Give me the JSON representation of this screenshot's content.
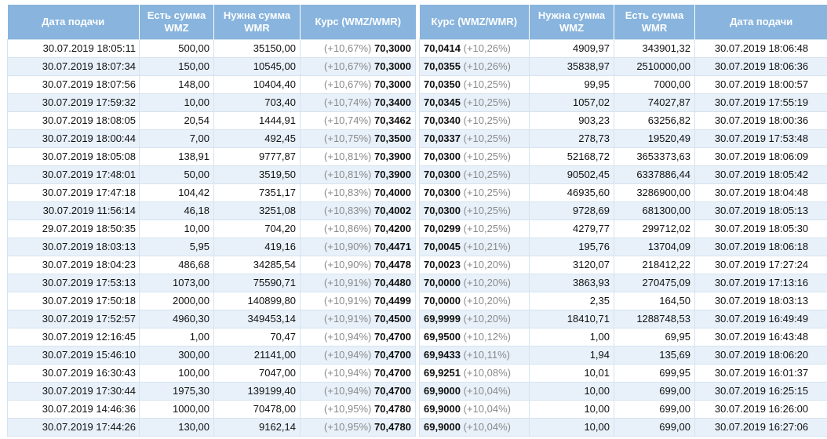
{
  "left_table": {
    "headers": [
      "Дата подачи",
      "Есть сумма WMZ",
      "Нужна сумма WMR",
      "Курс (WMZ/WMR)"
    ],
    "rows": [
      {
        "date": "30.07.2019 18:05:11",
        "have": "500,00",
        "need": "35150,00",
        "pct": "(+10,67%)",
        "rate": "70,3000"
      },
      {
        "date": "30.07.2019 18:07:34",
        "have": "150,00",
        "need": "10545,00",
        "pct": "(+10,67%)",
        "rate": "70,3000"
      },
      {
        "date": "30.07.2019 18:07:56",
        "have": "148,00",
        "need": "10404,40",
        "pct": "(+10,67%)",
        "rate": "70,3000"
      },
      {
        "date": "30.07.2019 17:59:32",
        "have": "10,00",
        "need": "703,40",
        "pct": "(+10,74%)",
        "rate": "70,3400"
      },
      {
        "date": "30.07.2019 18:08:05",
        "have": "20,54",
        "need": "1444,91",
        "pct": "(+10,74%)",
        "rate": "70,3462"
      },
      {
        "date": "30.07.2019 18:00:44",
        "have": "7,00",
        "need": "492,45",
        "pct": "(+10,75%)",
        "rate": "70,3500"
      },
      {
        "date": "30.07.2019 18:05:08",
        "have": "138,91",
        "need": "9777,87",
        "pct": "(+10,81%)",
        "rate": "70,3900"
      },
      {
        "date": "30.07.2019 17:48:01",
        "have": "50,00",
        "need": "3519,50",
        "pct": "(+10,81%)",
        "rate": "70,3900"
      },
      {
        "date": "30.07.2019 17:47:18",
        "have": "104,42",
        "need": "7351,17",
        "pct": "(+10,83%)",
        "rate": "70,4000"
      },
      {
        "date": "30.07.2019 11:56:14",
        "have": "46,18",
        "need": "3251,08",
        "pct": "(+10,83%)",
        "rate": "70,4002"
      },
      {
        "date": "29.07.2019 18:50:35",
        "have": "10,00",
        "need": "704,20",
        "pct": "(+10,86%)",
        "rate": "70,4200"
      },
      {
        "date": "30.07.2019 18:03:13",
        "have": "5,95",
        "need": "419,16",
        "pct": "(+10,90%)",
        "rate": "70,4471"
      },
      {
        "date": "30.07.2019 18:04:23",
        "have": "486,68",
        "need": "34285,54",
        "pct": "(+10,90%)",
        "rate": "70,4478"
      },
      {
        "date": "30.07.2019 17:53:13",
        "have": "1073,00",
        "need": "75590,71",
        "pct": "(+10,91%)",
        "rate": "70,4480"
      },
      {
        "date": "30.07.2019 17:50:18",
        "have": "2000,00",
        "need": "140899,80",
        "pct": "(+10,91%)",
        "rate": "70,4499"
      },
      {
        "date": "30.07.2019 17:52:57",
        "have": "4960,30",
        "need": "349453,14",
        "pct": "(+10,91%)",
        "rate": "70,4500"
      },
      {
        "date": "30.07.2019 12:16:45",
        "have": "1,00",
        "need": "70,47",
        "pct": "(+10,94%)",
        "rate": "70,4700"
      },
      {
        "date": "30.07.2019 15:46:10",
        "have": "300,00",
        "need": "21141,00",
        "pct": "(+10,94%)",
        "rate": "70,4700"
      },
      {
        "date": "30.07.2019 16:30:43",
        "have": "100,00",
        "need": "7047,00",
        "pct": "(+10,94%)",
        "rate": "70,4700"
      },
      {
        "date": "30.07.2019 17:30:44",
        "have": "1975,30",
        "need": "139199,40",
        "pct": "(+10,94%)",
        "rate": "70,4700"
      },
      {
        "date": "30.07.2019 14:46:36",
        "have": "1000,00",
        "need": "70478,00",
        "pct": "(+10,95%)",
        "rate": "70,4780"
      },
      {
        "date": "30.07.2019 17:44:26",
        "have": "130,00",
        "need": "9162,14",
        "pct": "(+10,95%)",
        "rate": "70,4780"
      }
    ]
  },
  "right_table": {
    "headers": [
      "Курс (WMZ/WMR)",
      "Нужна сумма WMZ",
      "Есть сумма WMR",
      "Дата подачи"
    ],
    "rows": [
      {
        "rate": "70,0414",
        "pct": "(+10,26%)",
        "need": "4909,97",
        "have": "343901,32",
        "date": "30.07.2019 18:06:48"
      },
      {
        "rate": "70,0355",
        "pct": "(+10,26%)",
        "need": "35838,97",
        "have": "2510000,00",
        "date": "30.07.2019 18:06:36"
      },
      {
        "rate": "70,0350",
        "pct": "(+10,25%)",
        "need": "99,95",
        "have": "7000,00",
        "date": "30.07.2019 18:00:57"
      },
      {
        "rate": "70,0345",
        "pct": "(+10,25%)",
        "need": "1057,02",
        "have": "74027,87",
        "date": "30.07.2019 17:55:19"
      },
      {
        "rate": "70,0340",
        "pct": "(+10,25%)",
        "need": "903,23",
        "have": "63256,82",
        "date": "30.07.2019 18:00:36"
      },
      {
        "rate": "70,0337",
        "pct": "(+10,25%)",
        "need": "278,73",
        "have": "19520,49",
        "date": "30.07.2019 17:53:48"
      },
      {
        "rate": "70,0300",
        "pct": "(+10,25%)",
        "need": "52168,72",
        "have": "3653373,63",
        "date": "30.07.2019 18:06:09"
      },
      {
        "rate": "70,0300",
        "pct": "(+10,25%)",
        "need": "90502,45",
        "have": "6337886,44",
        "date": "30.07.2019 18:05:42"
      },
      {
        "rate": "70,0300",
        "pct": "(+10,25%)",
        "need": "46935,60",
        "have": "3286900,00",
        "date": "30.07.2019 18:04:48"
      },
      {
        "rate": "70,0300",
        "pct": "(+10,25%)",
        "need": "9728,69",
        "have": "681300,00",
        "date": "30.07.2019 18:05:13"
      },
      {
        "rate": "70,0299",
        "pct": "(+10,25%)",
        "need": "4279,77",
        "have": "299712,02",
        "date": "30.07.2019 18:05:30"
      },
      {
        "rate": "70,0045",
        "pct": "(+10,21%)",
        "need": "195,76",
        "have": "13704,09",
        "date": "30.07.2019 18:06:18"
      },
      {
        "rate": "70,0023",
        "pct": "(+10,20%)",
        "need": "3120,07",
        "have": "218412,22",
        "date": "30.07.2019 17:27:24"
      },
      {
        "rate": "70,0000",
        "pct": "(+10,20%)",
        "need": "3863,93",
        "have": "270475,09",
        "date": "30.07.2019 17:13:16"
      },
      {
        "rate": "70,0000",
        "pct": "(+10,20%)",
        "need": "2,35",
        "have": "164,50",
        "date": "30.07.2019 18:03:13"
      },
      {
        "rate": "69,9999",
        "pct": "(+10,20%)",
        "need": "18410,71",
        "have": "1288748,53",
        "date": "30.07.2019 16:49:49"
      },
      {
        "rate": "69,9500",
        "pct": "(+10,12%)",
        "need": "1,00",
        "have": "69,95",
        "date": "30.07.2019 16:43:48"
      },
      {
        "rate": "69,9433",
        "pct": "(+10,11%)",
        "need": "1,94",
        "have": "135,69",
        "date": "30.07.2019 18:06:20"
      },
      {
        "rate": "69,9251",
        "pct": "(+10,08%)",
        "need": "10,01",
        "have": "699,95",
        "date": "30.07.2019 16:01:37"
      },
      {
        "rate": "69,9000",
        "pct": "(+10,04%)",
        "need": "10,00",
        "have": "699,00",
        "date": "30.07.2019 16:25:15"
      },
      {
        "rate": "69,9000",
        "pct": "(+10,04%)",
        "need": "10,00",
        "have": "699,00",
        "date": "30.07.2019 16:26:00"
      },
      {
        "rate": "69,9000",
        "pct": "(+10,04%)",
        "need": "10,00",
        "have": "699,00",
        "date": "30.07.2019 16:27:06"
      }
    ]
  }
}
